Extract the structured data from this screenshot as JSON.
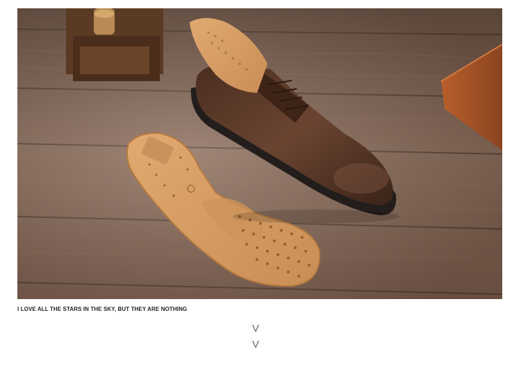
{
  "caption": {
    "text": "I LOVE ALL THE STARS IN THE SKY, BUT THEY ARE NOTHING"
  },
  "scroll_hint": {
    "glyph_top": "V",
    "glyph_bottom": "V",
    "color": "#666666"
  },
  "photo": {
    "colors": {
      "wood": "#7a5c4b",
      "shoe_leather": "#5a3a28",
      "insole": "#d9a064",
      "sole": "#2a2422"
    }
  }
}
